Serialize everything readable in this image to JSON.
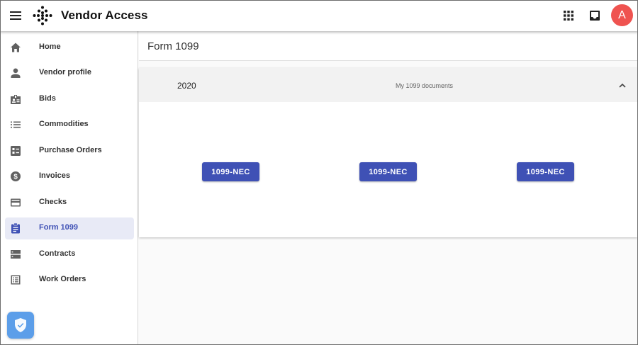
{
  "header": {
    "app_title": "Vendor Access",
    "menu_icon": "hamburger-menu-icon",
    "logo_icon": "diamond-dots-logo",
    "apps_icon": "apps-grid-icon",
    "inbox_icon": "inbox-icon",
    "avatar_initial": "A",
    "avatar_color": "#ef5350"
  },
  "sidebar": {
    "items": [
      {
        "label": "Home",
        "icon": "home-icon"
      },
      {
        "label": "Vendor profile",
        "icon": "person-icon"
      },
      {
        "label": "Bids",
        "icon": "badge-icon"
      },
      {
        "label": "Commodities",
        "icon": "list-icon"
      },
      {
        "label": "Purchase Orders",
        "icon": "order-list-icon"
      },
      {
        "label": "Invoices",
        "icon": "dollar-coin-icon"
      },
      {
        "label": "Checks",
        "icon": "credit-card-icon"
      },
      {
        "label": "Form 1099",
        "icon": "clipboard-icon",
        "active": true
      },
      {
        "label": "Contracts",
        "icon": "storage-icon"
      },
      {
        "label": "Work Orders",
        "icon": "checklist-icon"
      }
    ],
    "security_badge_icon": "shield-check-icon"
  },
  "main": {
    "page_title": "Form 1099",
    "panel": {
      "year": "2020",
      "description": "My 1099 documents",
      "expanded": true,
      "documents": [
        {
          "label": "1099-NEC"
        },
        {
          "label": "1099-NEC"
        },
        {
          "label": "1099-NEC"
        }
      ]
    }
  },
  "colors": {
    "accent": "#3f51b5",
    "active_bg": "#e8eaf6",
    "panel_header_bg": "#f2f2f2",
    "page_bg": "#fafafa",
    "shield_bg": "#5c9ee9"
  }
}
